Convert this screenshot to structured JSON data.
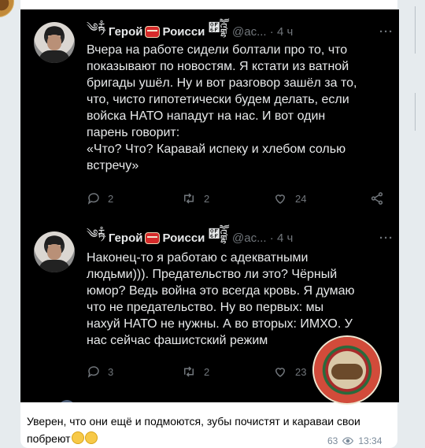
{
  "tweets": [
    {
      "name": "Герой",
      "name2": "Роисси",
      "deco_left": "༄ྟརཾ",
      "deco_right": "཯འྒྷཽ",
      "handle": "@ac...",
      "time": "· 4 ч",
      "more": "···",
      "text": "Вчера на работе сидели болтали про то, что\nпоказывают по новостям. Я кстати из ватной\nбригады ушёл. Ну и вот разговор зашёл за то,\nчто, чисто гипотетически будем делать, если\nвойска НАТО нападут на нас. И вот один\nпарень говорит:\n«Что? Что? Каравай испеку и хлебом солью\nвстречу»",
      "replies": "2",
      "retweets": "2",
      "likes": "24"
    },
    {
      "name": "Герой",
      "name2": "Роисси",
      "deco_left": "༄ྟརཾ",
      "deco_right": "཯འྒྷཽ",
      "handle": "@ac...",
      "time": "· 4 ч",
      "more": "···",
      "text": "Наконец-то я работаю с адекватными\nлюдьми))). Предательство ли это? Чёрный\nюмор? Ведь война это всегда кровь. Я думаю\nчто не предательство. Ну во первых: мы\nнахуй НАТО не нужны. А во вторых: ИМХО. У\nнас сейчас фашистский режим",
      "replies": "3",
      "retweets": "2",
      "likes": "23"
    }
  ],
  "message": {
    "text": "Уверен, что они ещё и подмоются, зубы почистят и караваи свои побреют",
    "views": "63",
    "time": "13:34"
  },
  "colors": {
    "tweet_bg": "#000000",
    "tweet_text": "#e7e9ea",
    "muted": "#71767b",
    "chat_bg": "#e6ebee",
    "meta": "#7a8a9a"
  }
}
